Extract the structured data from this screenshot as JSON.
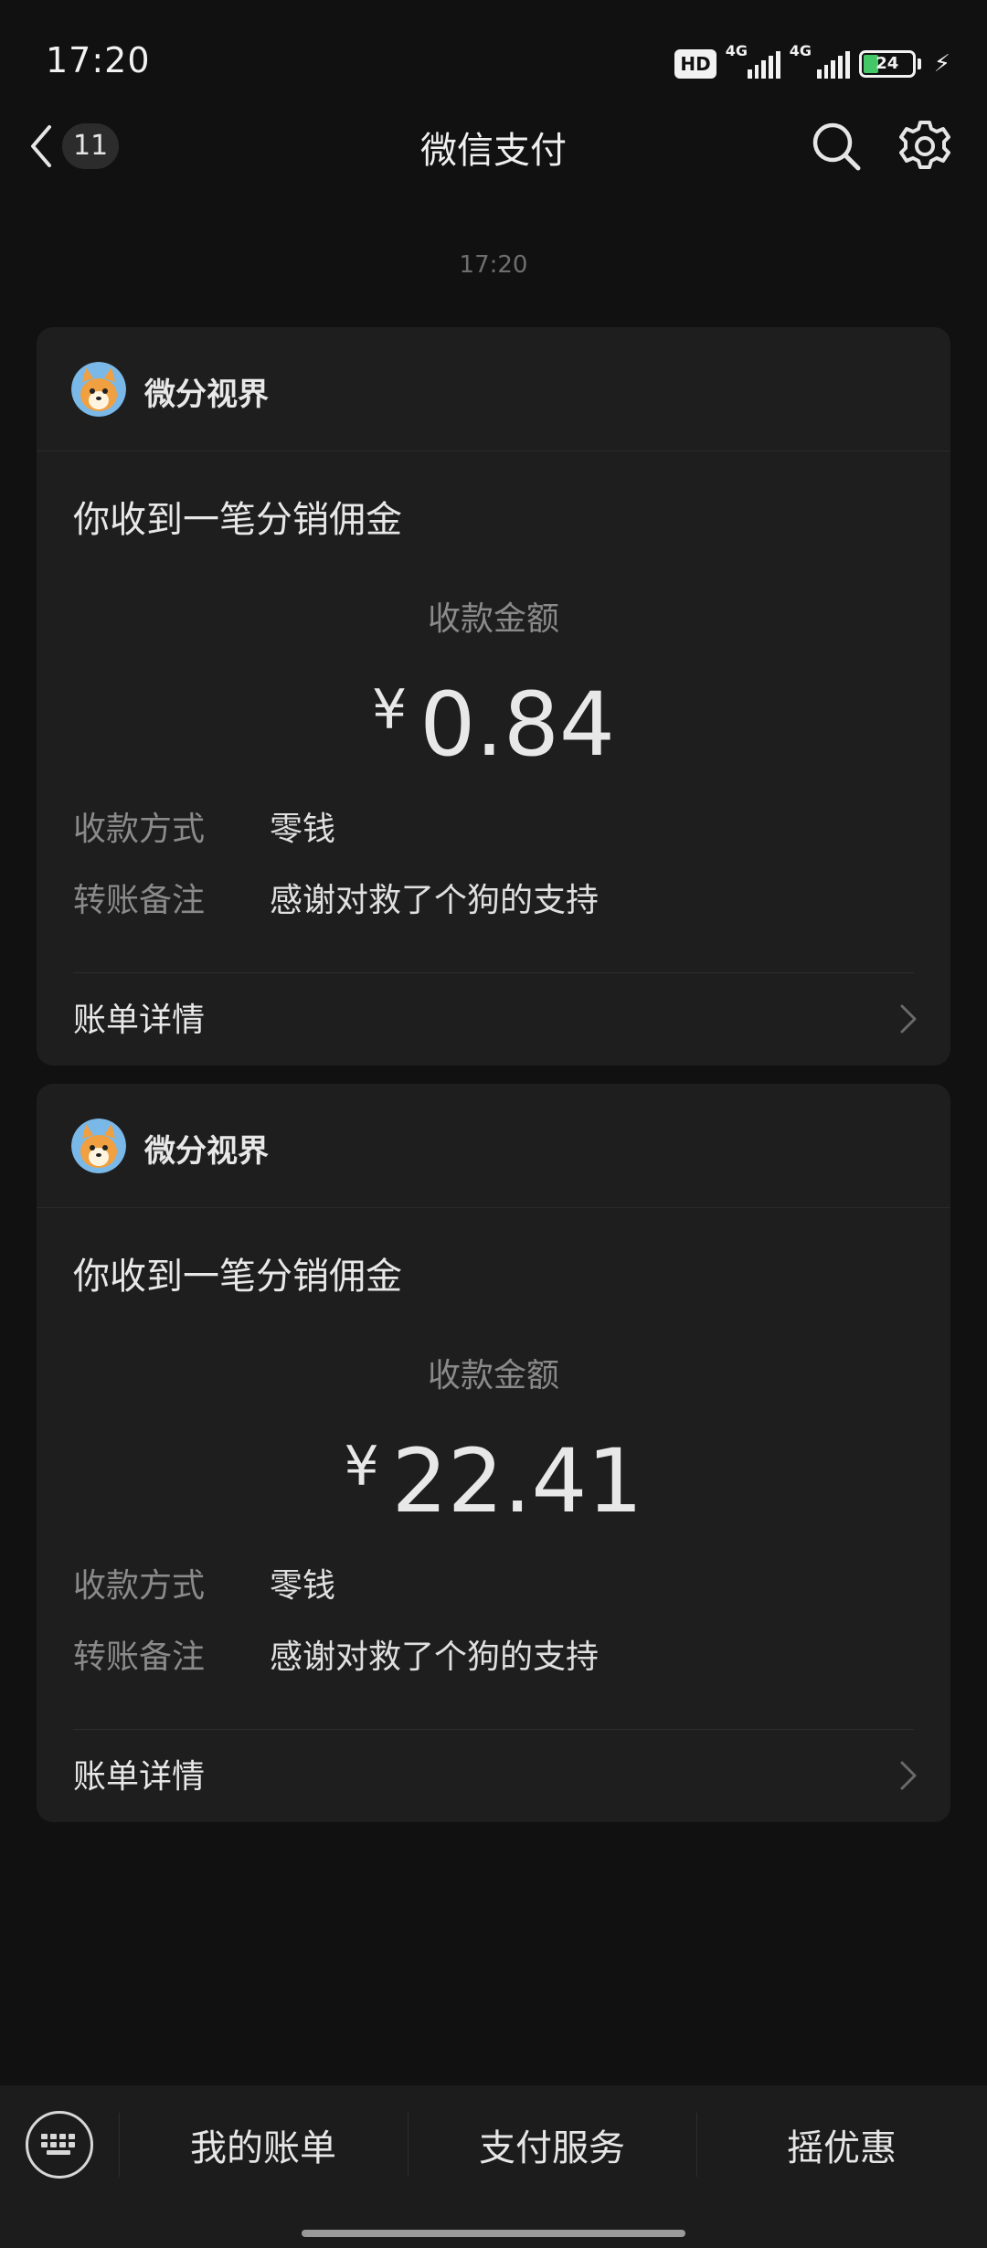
{
  "status_bar": {
    "time": "17:20",
    "hd_label": "HD",
    "network_1": "4G",
    "network_2": "4G",
    "battery_level": "24"
  },
  "nav": {
    "unread_count": "11",
    "title": "微信支付"
  },
  "timestamp": "17:20",
  "cards": [
    {
      "sender": "微分视界",
      "title": "你收到一笔分销佣金",
      "amount_label": "收款金额",
      "currency": "¥",
      "amount": "0.84",
      "method_label": "收款方式",
      "method_value": "零钱",
      "note_label": "转账备注",
      "note_value": "感谢对救了个狗的支持",
      "detail_label": "账单详情"
    },
    {
      "sender": "微分视界",
      "title": "你收到一笔分销佣金",
      "amount_label": "收款金额",
      "currency": "¥",
      "amount": "22.41",
      "method_label": "收款方式",
      "method_value": "零钱",
      "note_label": "转账备注",
      "note_value": "感谢对救了个狗的支持",
      "detail_label": "账单详情"
    }
  ],
  "bottom_menu": {
    "items": [
      "我的账单",
      "支付服务",
      "摇优惠"
    ]
  },
  "icons": {
    "back": "chevron-left-icon",
    "search": "search-icon",
    "settings": "gear-icon",
    "keyboard": "keyboard-icon",
    "detail": "chevron-right-icon"
  },
  "colors": {
    "background": "#111111",
    "card": "#1e1e1e",
    "battery": "#44c767"
  }
}
